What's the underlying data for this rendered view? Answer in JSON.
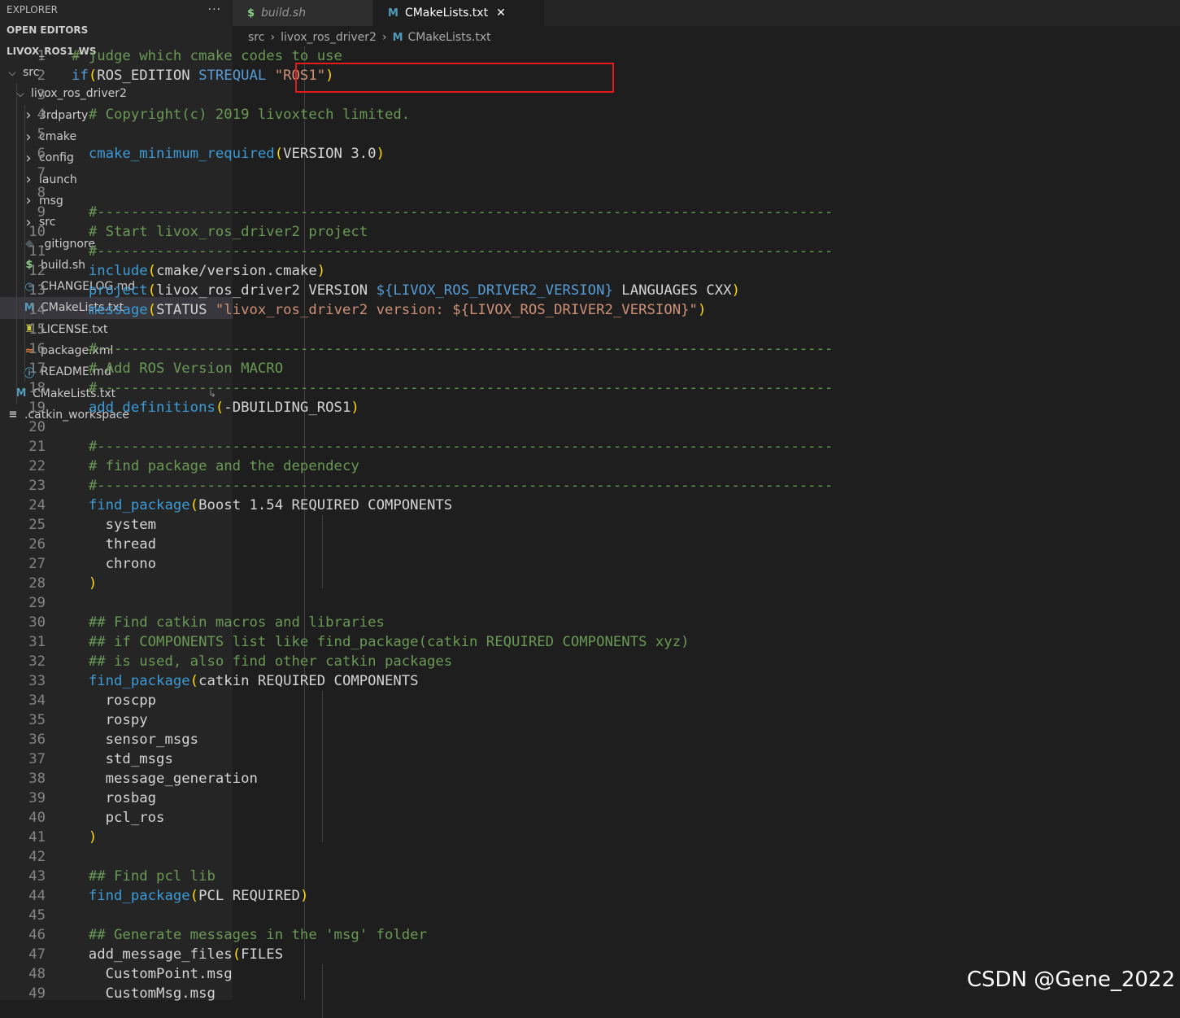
{
  "explorer": {
    "title": "EXPLORER",
    "more": "···",
    "open_editors": "OPEN EDITORS",
    "workspace": "LIVOX_ROS1_WS"
  },
  "tree": [
    {
      "label": "src",
      "kind": "folder-open",
      "depth": 0
    },
    {
      "label": "livox_ros_driver2",
      "kind": "folder-open",
      "depth": 1
    },
    {
      "label": "3rdparty",
      "kind": "folder",
      "depth": 2
    },
    {
      "label": "cmake",
      "kind": "folder",
      "depth": 2
    },
    {
      "label": "config",
      "kind": "folder",
      "depth": 2
    },
    {
      "label": "launch",
      "kind": "folder",
      "depth": 2
    },
    {
      "label": "msg",
      "kind": "folder",
      "depth": 2
    },
    {
      "label": "src",
      "kind": "folder",
      "depth": 2
    },
    {
      "label": ".gitignore",
      "kind": "file",
      "icon": "◆",
      "iconColor": "#4d5a61",
      "depth": 2
    },
    {
      "label": "build.sh",
      "kind": "file",
      "icon": "$",
      "iconColor": "#89d185",
      "depth": 2
    },
    {
      "label": "CHANGELOG.md",
      "kind": "file",
      "icon": "◷",
      "iconColor": "#519aba",
      "depth": 2
    },
    {
      "label": "CMakeLists.txt",
      "kind": "file",
      "icon": "M",
      "iconColor": "#519aba",
      "depth": 2,
      "selected": true
    },
    {
      "label": "LICENSE.txt",
      "kind": "file",
      "icon": "♜",
      "iconColor": "#cbcb41",
      "depth": 2
    },
    {
      "label": "package.xml",
      "kind": "file",
      "icon": "≈",
      "iconColor": "#e37933",
      "depth": 2
    },
    {
      "label": "README.md",
      "kind": "file",
      "icon": "ⓘ",
      "iconColor": "#519aba",
      "depth": 2
    },
    {
      "label": "CMakeLists.txt",
      "kind": "file",
      "icon": "M",
      "iconColor": "#519aba",
      "depth": 1,
      "badge": "↳"
    },
    {
      "label": ".catkin_workspace",
      "kind": "file",
      "icon": "≡",
      "iconColor": "#cccccc",
      "depth": 0
    }
  ],
  "tabs": [
    {
      "label": "build.sh",
      "icon": "$",
      "iconColor": "#89d185",
      "active": false
    },
    {
      "label": "CMakeLists.txt",
      "icon": "M",
      "iconColor": "#519aba",
      "active": true,
      "close": "✕"
    }
  ],
  "breadcrumb": [
    "src",
    "livox_ros_driver2",
    "CMakeLists.txt"
  ],
  "code_lines": [
    [
      [
        "cmt",
        "# judge which cmake codes to use"
      ]
    ],
    [
      [
        "kw",
        "if"
      ],
      [
        "pn",
        "("
      ],
      [
        "",
        "ROS_EDITION "
      ],
      [
        "kw",
        "STREQUAL"
      ],
      [
        "",
        " "
      ],
      [
        "str",
        "\"ROS1\""
      ],
      [
        "pn",
        ")"
      ]
    ],
    [],
    [
      [
        "",
        "  "
      ],
      [
        "cmt",
        "# Copyright(c) 2019 livoxtech limited."
      ]
    ],
    [],
    [
      [
        "",
        "  "
      ],
      [
        "fn",
        "cmake_minimum_required"
      ],
      [
        "pn",
        "("
      ],
      [
        "",
        "VERSION 3.0"
      ],
      [
        "pn",
        ")"
      ]
    ],
    [],
    [],
    [
      [
        "",
        "  "
      ],
      [
        "cmt",
        "#---------------------------------------------------------------------------------------"
      ]
    ],
    [
      [
        "",
        "  "
      ],
      [
        "cmt",
        "# Start livox_ros_driver2 project"
      ]
    ],
    [
      [
        "",
        "  "
      ],
      [
        "cmt",
        "#---------------------------------------------------------------------------------------"
      ]
    ],
    [
      [
        "",
        "  "
      ],
      [
        "fn",
        "include"
      ],
      [
        "pn",
        "("
      ],
      [
        "",
        "cmake/version.cmake"
      ],
      [
        "pn",
        ")"
      ]
    ],
    [
      [
        "",
        "  "
      ],
      [
        "fn",
        "project"
      ],
      [
        "pn",
        "("
      ],
      [
        "",
        "livox_ros_driver2 VERSION "
      ],
      [
        "var",
        "${LIVOX_ROS_DRIVER2_VERSION}"
      ],
      [
        "",
        " LANGUAGES CXX"
      ],
      [
        "pn",
        ")"
      ]
    ],
    [
      [
        "",
        "  "
      ],
      [
        "fn",
        "message"
      ],
      [
        "pn",
        "("
      ],
      [
        "",
        "STATUS "
      ],
      [
        "str",
        "\"livox_ros_driver2 version: ${LIVOX_ROS_DRIVER2_VERSION}\""
      ],
      [
        "pn",
        ")"
      ]
    ],
    [],
    [
      [
        "",
        "  "
      ],
      [
        "cmt",
        "#---------------------------------------------------------------------------------------"
      ]
    ],
    [
      [
        "",
        "  "
      ],
      [
        "cmt",
        "# Add ROS Version MACRO"
      ]
    ],
    [
      [
        "",
        "  "
      ],
      [
        "cmt",
        "#---------------------------------------------------------------------------------------"
      ]
    ],
    [
      [
        "",
        "  "
      ],
      [
        "fn",
        "add_definitions"
      ],
      [
        "pn",
        "("
      ],
      [
        "",
        "-DBUILDING_ROS1"
      ],
      [
        "pn",
        ")"
      ]
    ],
    [],
    [
      [
        "",
        "  "
      ],
      [
        "cmt",
        "#---------------------------------------------------------------------------------------"
      ]
    ],
    [
      [
        "",
        "  "
      ],
      [
        "cmt",
        "# find package and the dependecy"
      ]
    ],
    [
      [
        "",
        "  "
      ],
      [
        "cmt",
        "#---------------------------------------------------------------------------------------"
      ]
    ],
    [
      [
        "",
        "  "
      ],
      [
        "fn",
        "find_package"
      ],
      [
        "pn",
        "("
      ],
      [
        "",
        "Boost 1.54 REQUIRED COMPONENTS"
      ]
    ],
    [
      [
        "",
        "    system"
      ]
    ],
    [
      [
        "",
        "    thread"
      ]
    ],
    [
      [
        "",
        "    chrono"
      ]
    ],
    [
      [
        "",
        "  "
      ],
      [
        "pn",
        ")"
      ]
    ],
    [],
    [
      [
        "",
        "  "
      ],
      [
        "cmt",
        "## Find catkin macros and libraries"
      ]
    ],
    [
      [
        "",
        "  "
      ],
      [
        "cmt",
        "## if COMPONENTS list like find_package(catkin REQUIRED COMPONENTS xyz)"
      ]
    ],
    [
      [
        "",
        "  "
      ],
      [
        "cmt",
        "## is used, also find other catkin packages"
      ]
    ],
    [
      [
        "",
        "  "
      ],
      [
        "fn",
        "find_package"
      ],
      [
        "pn",
        "("
      ],
      [
        "",
        "catkin REQUIRED COMPONENTS"
      ]
    ],
    [
      [
        "",
        "    roscpp"
      ]
    ],
    [
      [
        "",
        "    rospy"
      ]
    ],
    [
      [
        "",
        "    sensor_msgs"
      ]
    ],
    [
      [
        "",
        "    std_msgs"
      ]
    ],
    [
      [
        "",
        "    message_generation"
      ]
    ],
    [
      [
        "",
        "    rosbag"
      ]
    ],
    [
      [
        "",
        "    pcl_ros"
      ]
    ],
    [
      [
        "",
        "  "
      ],
      [
        "pn",
        ")"
      ]
    ],
    [],
    [
      [
        "",
        "  "
      ],
      [
        "cmt",
        "## Find pcl lib"
      ]
    ],
    [
      [
        "",
        "  "
      ],
      [
        "fn",
        "find_package"
      ],
      [
        "pn",
        "("
      ],
      [
        "",
        "PCL REQUIRED"
      ],
      [
        "pn",
        ")"
      ]
    ],
    [],
    [
      [
        "",
        "  "
      ],
      [
        "cmt",
        "## Generate messages in the 'msg' folder"
      ]
    ],
    [
      [
        "",
        "  add_message_files"
      ],
      [
        "pn",
        "("
      ],
      [
        "",
        "FILES"
      ]
    ],
    [
      [
        "",
        "    CustomPoint.msg"
      ]
    ],
    [
      [
        "",
        "    CustomMsg.msg"
      ]
    ]
  ],
  "watermark": "CSDN @Gene_2022"
}
